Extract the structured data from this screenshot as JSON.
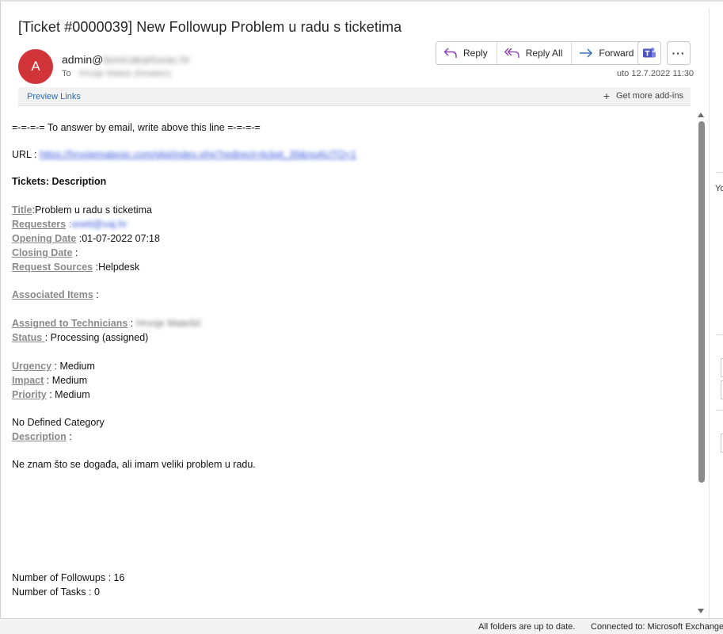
{
  "email": {
    "subject": "[Ticket #0000039] New Followup Problem u radu s ticketima",
    "avatar_initial": "A",
    "from_prefix": "admin@",
    "from_domain": "bonicakarlovac.hr",
    "to_label": "To",
    "to_value": "Hrvoje Mateic (hmateic)",
    "date": "uto 12.7.2022 11:30"
  },
  "toolbar": {
    "reply_label": "Reply",
    "reply_all_label": "Reply All",
    "forward_label": "Forward",
    "more_label": "···"
  },
  "addins": {
    "preview_links": "Preview Links",
    "get_more": "Get more add-ins"
  },
  "body": {
    "answer_line": "=-=-=-= To answer by email, write above this line =-=-=-=",
    "url_label": "URL :",
    "url_value": "https://hrvojemateoic.com/glpi/index.php?redirect=ticket_39&noAUTO=1",
    "section_title": "Tickets: Description",
    "title_label": "Title",
    "title_value": ":Problem u radu s ticketima",
    "requesters_label": "Requesters",
    "requesters_value": "oneti@vaj.hr",
    "opening_label": "Opening Date",
    "opening_value": ":01-07-2022 07:18",
    "closing_label": "Closing Date",
    "closing_value": " :",
    "sources_label": "Request Sources",
    "sources_value": ":Helpdesk",
    "assoc_label": "Associated Items",
    "assoc_value": " :",
    "tech_label": "Assigned to Technicians",
    "tech_value": "Hrvoje Matešić",
    "status_label": "Status ",
    "status_value": " : Processing (assigned)",
    "urgency_label": "Urgency",
    "urgency_value": " : Medium",
    "impact_label": "Impact",
    "impact_value": " : Medium",
    "priority_label": "Priority",
    "priority_value": " : Medium",
    "category": "No Defined Category",
    "description_label": "Description",
    "description_value": " :",
    "description_text": "Ne znam što se događa, ali imam veliki problem u radu.",
    "followups": "Number of Followups : 16",
    "tasks": "Number of Tasks : 0"
  },
  "right_pane": {
    "clip_text": "Yo"
  },
  "statusbar": {
    "sync": "All folders are up to date.",
    "connection": "Connected to: Microsoft Exchange"
  },
  "colors": {
    "avatar": "#d13438",
    "link": "#2b6cb0",
    "label_gray": "#8a8a8a"
  }
}
